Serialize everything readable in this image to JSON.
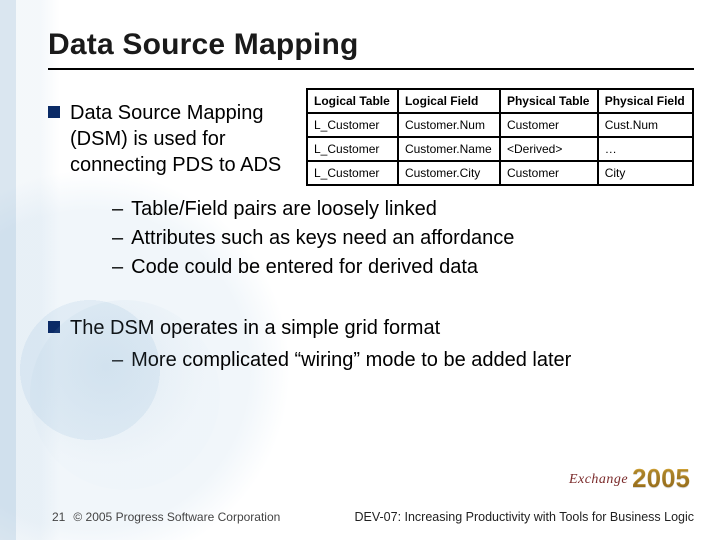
{
  "title": "Data Source Mapping",
  "main_bullet_1": "Data Source Mapping (DSM) is used for connecting PDS to ADS",
  "table": {
    "headers": [
      "Logical Table",
      "Logical Field",
      "Physical Table",
      "Physical Field"
    ],
    "rows": [
      [
        "L_Customer",
        "Customer.Num",
        "Customer",
        "Cust.Num"
      ],
      [
        "L_Customer",
        "Customer.Name",
        "<Derived>",
        "…"
      ],
      [
        "L_Customer",
        "Customer.City",
        "Customer",
        "City"
      ]
    ]
  },
  "sub_items_1": [
    "Table/Field pairs are loosely linked",
    "Attributes such as keys need an affordance",
    "Code could be entered for derived data"
  ],
  "main_bullet_2": "The DSM operates in a simple grid format",
  "sub_items_2": [
    "More complicated “wiring” mode to be added later"
  ],
  "dash": "–",
  "footer": {
    "page": "21",
    "copyright": "© 2005 Progress Software Corporation",
    "session": "DEV-07: Increasing Productivity with Tools for Business Logic"
  },
  "logo": {
    "brand": "Exchange",
    "year": "2005"
  }
}
